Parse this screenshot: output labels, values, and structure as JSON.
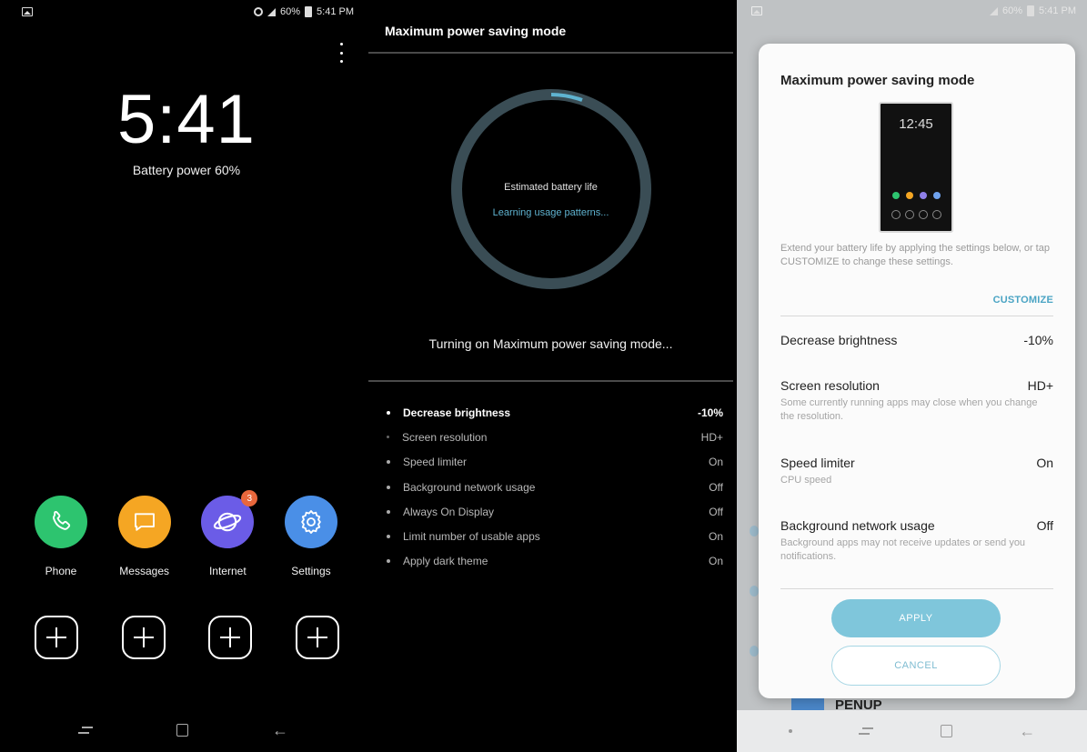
{
  "panel1": {
    "status": {
      "battery": "60%",
      "time": "5:41 PM"
    },
    "clock": "5:41",
    "battery_text": "Battery power 60%",
    "apps": [
      {
        "label": "Phone",
        "color": "#2dc46f",
        "icon": "phone-icon"
      },
      {
        "label": "Messages",
        "color": "#f5a623",
        "icon": "messages-icon"
      },
      {
        "label": "Internet",
        "color": "#6b5ce7",
        "icon": "internet-icon",
        "badge": "3"
      },
      {
        "label": "Settings",
        "color": "#4a8fe7",
        "icon": "settings-icon"
      }
    ]
  },
  "panel2": {
    "title": "Maximum power saving mode",
    "ring_label": "Estimated battery life",
    "ring_sub": "Learning usage patterns...",
    "status": "Turning on Maximum power saving mode...",
    "items": [
      {
        "label": "Decrease brightness",
        "value": "-10%"
      },
      {
        "label": "Screen resolution",
        "value": "HD+"
      },
      {
        "label": "Speed limiter",
        "value": "On"
      },
      {
        "label": "Background network usage",
        "value": "Off"
      },
      {
        "label": "Always On Display",
        "value": "Off"
      },
      {
        "label": "Limit number of usable apps",
        "value": "On"
      },
      {
        "label": "Apply dark theme",
        "value": "On"
      }
    ]
  },
  "panel3": {
    "status": {
      "battery": "60%",
      "time": "5:41 PM"
    },
    "title": "Maximum power saving mode",
    "preview_clock": "12:45",
    "description": "Extend your battery life by applying the settings below, or tap CUSTOMIZE to change these settings.",
    "customize": "CUSTOMIZE",
    "items": [
      {
        "label": "Decrease brightness",
        "value": "-10%",
        "sub": ""
      },
      {
        "label": "Screen resolution",
        "value": "HD+",
        "sub": "Some currently running apps may close when you change the resolution."
      },
      {
        "label": "Speed limiter",
        "value": "On",
        "sub": "CPU speed"
      },
      {
        "label": "Background network usage",
        "value": "Off",
        "sub": "Background apps may not receive updates or send you notifications."
      }
    ],
    "apply": "APPLY",
    "cancel": "CANCEL",
    "behind_label": "PENUP",
    "colors": {
      "accent": "#4aa4c4",
      "apply_bg": "#7fc6db"
    }
  }
}
